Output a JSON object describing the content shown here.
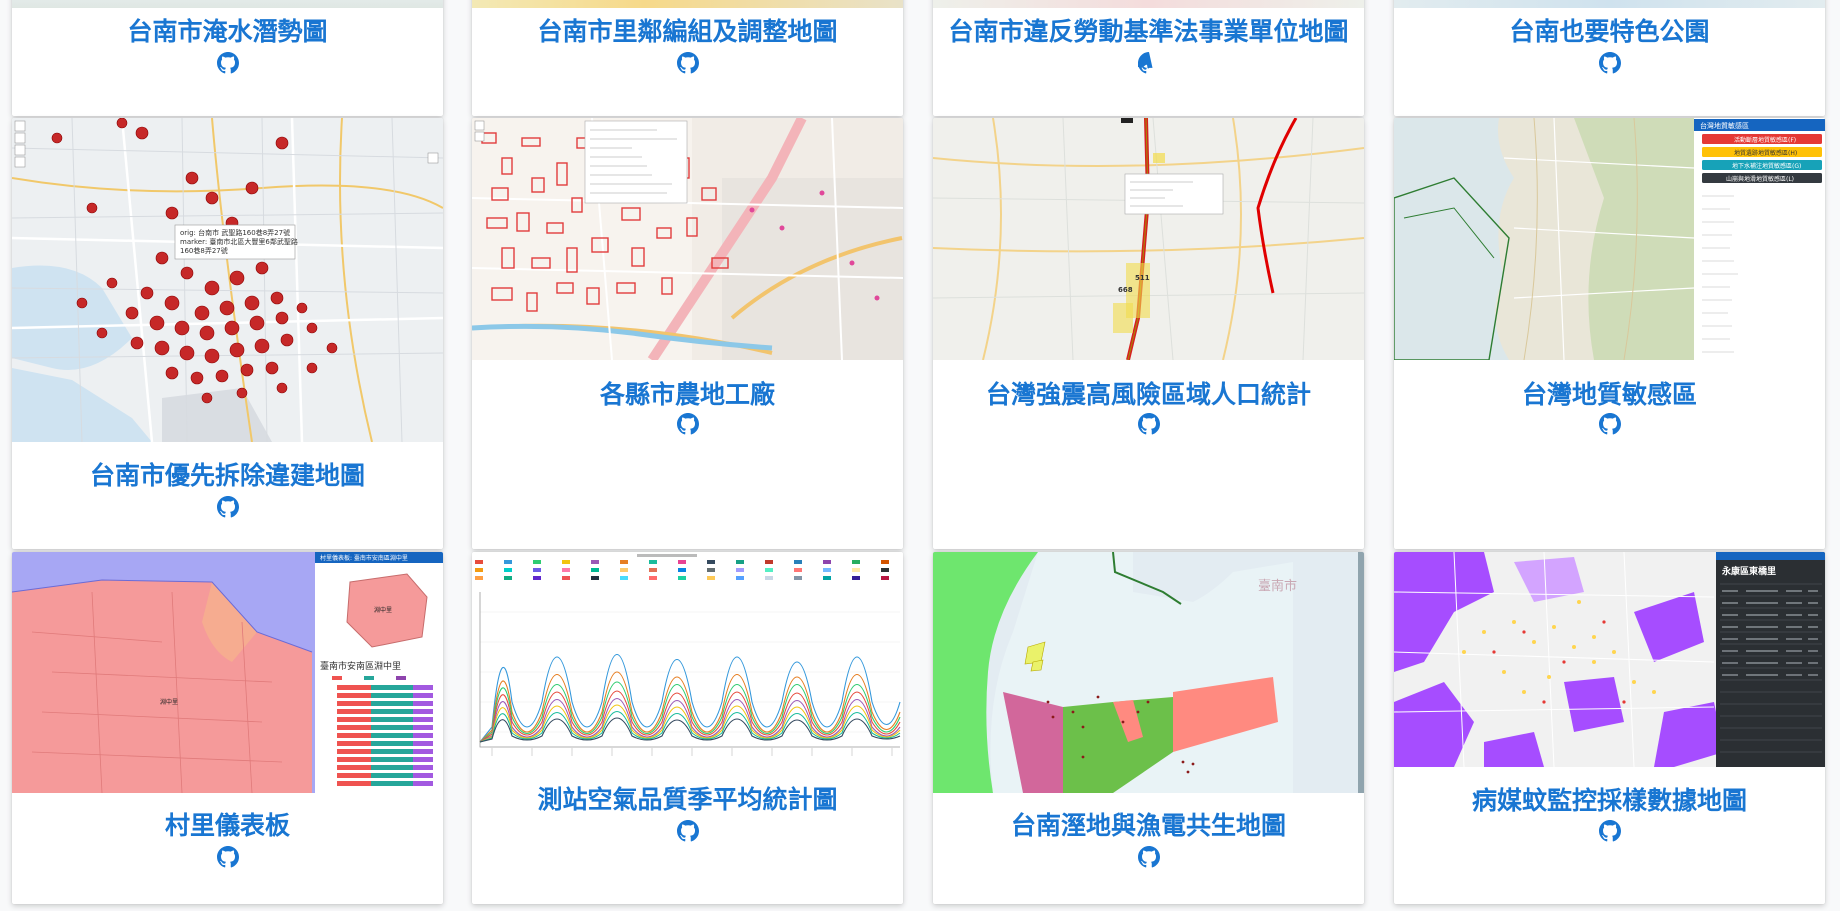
{
  "cards": [
    {
      "title": "台南市淹水潛勢圖",
      "link_icon": "github-icon"
    },
    {
      "title": "台南市里鄰編組及調整地圖",
      "link_icon": "github-icon"
    },
    {
      "title": "台南市違反勞動基準法事業單位地圖",
      "link_icon": "github-icon"
    },
    {
      "title": "台南也要特色公園",
      "link_icon": "github-icon"
    },
    {
      "title": "台南市優先拆除違建地圖",
      "link_icon": "github-icon"
    },
    {
      "title": "各縣市農地工廠",
      "link_icon": "github-icon"
    },
    {
      "title": "台灣強震高風險區域人口統計",
      "link_icon": "github-icon"
    },
    {
      "title": "台灣地質敏感區",
      "link_icon": "github-icon"
    },
    {
      "title": "村里儀表板",
      "link_icon": "github-icon"
    },
    {
      "title": "測站空氣品質季平均統計圖",
      "link_icon": "github-icon"
    },
    {
      "title": "台南溼地與漁電共生地圖",
      "link_icon": "github-icon"
    },
    {
      "title": "病媒蚊監控採樣數據地圖",
      "link_icon": "github-icon"
    }
  ],
  "thumb_text": {
    "popup1_line1": "orig: 台南市 武聖路160巷8弄27號",
    "popup1_line2": "marker: 臺南市北區大豐里6鄰武聖路",
    "popup1_line3": "160巷8弄27號",
    "geo_panel_header": "台灣地質敏感區",
    "geo_btn_1": "活動斷層地質敏感區(F)",
    "geo_btn_2": "地質遺跡地質敏感區(H)",
    "geo_btn_3": "地下水補注地質敏感區(G)",
    "geo_btn_4": "山崩與地滑地質敏感區(L)",
    "village_panel_header": "村里儀表板: 臺南市安南區淵中里",
    "village_name": "臺南市安南區淵中里",
    "village_shape_label": "淵中里",
    "village_map_label": "淵中里",
    "city_label": "臺南市",
    "mosquito_panel_header": "永康區東橋里",
    "quake_label_1": "511",
    "quake_label_2": "668"
  },
  "colors": {
    "title_blue": "#1976d2",
    "star_red": "#c62828",
    "route_red": "#e00000",
    "wetland_green": "#6ee66e",
    "wetland_pink": "#ff8a80",
    "mosquito_purple": "#a64dff"
  }
}
